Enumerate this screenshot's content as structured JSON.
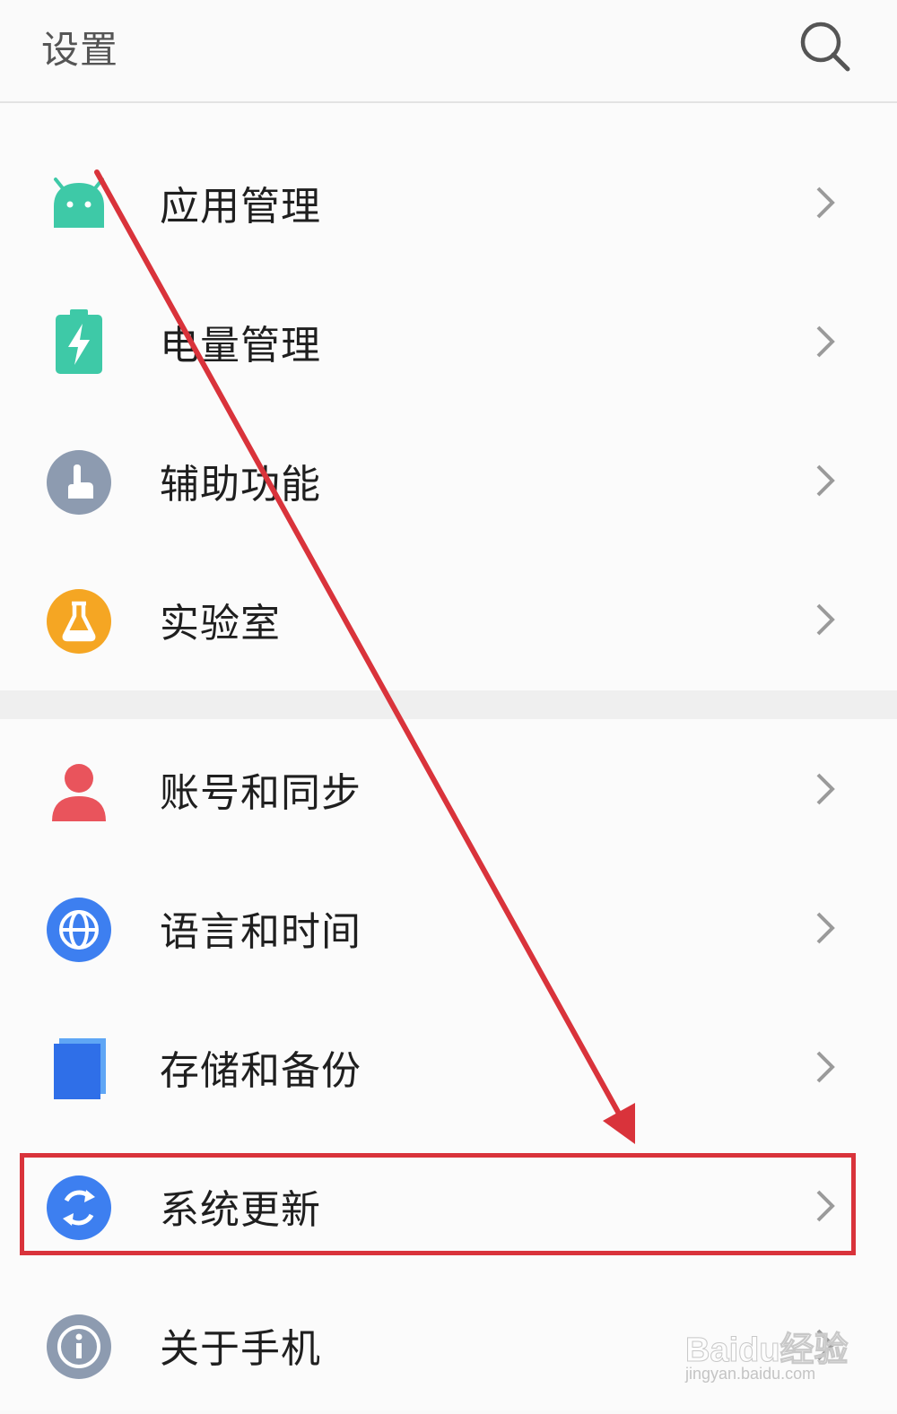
{
  "header": {
    "title": "设置",
    "search_icon": "search-icon"
  },
  "settings": [
    {
      "label": "应用管理",
      "icon": "android-app-icon",
      "color": "#3ec9a7"
    },
    {
      "label": "电量管理",
      "icon": "battery-icon",
      "color": "#3ec9a7"
    },
    {
      "label": "辅助功能",
      "icon": "touch-hand-icon",
      "color": "#8d9bb0"
    },
    {
      "label": "实验室",
      "icon": "flask-icon",
      "color": "#f5a623"
    },
    {
      "label": "账号和同步",
      "icon": "person-icon",
      "color": "#e9545c"
    },
    {
      "label": "语言和时间",
      "icon": "globe-icon",
      "color": "#3d7ff0"
    },
    {
      "label": "存储和备份",
      "icon": "storage-icon",
      "color": "#2f6fe8"
    },
    {
      "label": "系统更新",
      "icon": "sync-icon",
      "color": "#3d7ff0",
      "highlighted": true
    },
    {
      "label": "关于手机",
      "icon": "info-icon",
      "color": "#8d9bb0"
    }
  ],
  "annotation": {
    "arrow_color": "#d9333b",
    "highlight_color": "#d9333b"
  },
  "watermark": {
    "main": "Baidu经验",
    "sub": "jingyan.baidu.com"
  }
}
